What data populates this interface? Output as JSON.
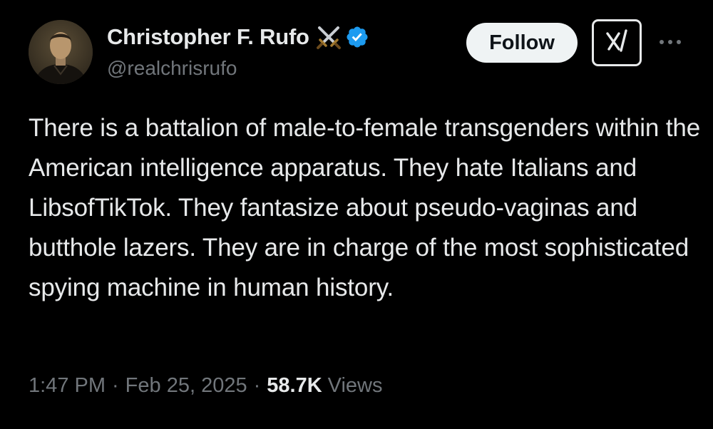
{
  "author": {
    "display_name": "Christopher F. Rufo",
    "handle": "@realchrisrufo",
    "name_emoji": "crossed-swords-icon",
    "verified": true,
    "verified_color": "#1d9bf0"
  },
  "actions": {
    "follow_label": "Follow",
    "grok_icon": "grok-icon",
    "more_icon": "more-dots-icon"
  },
  "tweet": {
    "text": "There is a battalion of male-to-female transgenders within the American intelligence apparatus. They hate Italians and LibsofTikTok. They fantasize about pseudo-vaginas and butthole lazers. They are in charge of the most sophisticated spying machine in human history."
  },
  "meta": {
    "time": "1:47 PM",
    "separator": "·",
    "date": "Feb 25, 2025",
    "views_count": "58.7K",
    "views_label": "Views"
  },
  "colors": {
    "background": "#000000",
    "primary_text": "#e7e9ea",
    "secondary_text": "#71767b",
    "follow_bg": "#eff3f4"
  }
}
